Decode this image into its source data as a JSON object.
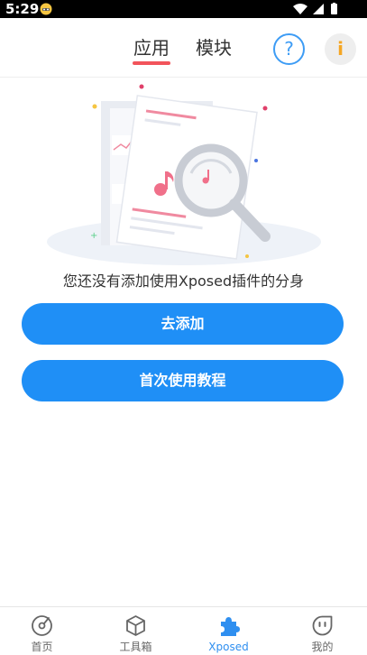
{
  "status_bar": {
    "time": "5:29"
  },
  "header": {
    "tabs": [
      {
        "label": "应用",
        "active": true
      },
      {
        "label": "模块",
        "active": false
      }
    ],
    "help_icon_glyph": "?",
    "info_icon_glyph": "i",
    "underline_color": "#f2545b"
  },
  "main": {
    "empty_message": "您还没有添加使用Xposed插件的分身",
    "add_button_label": "去添加",
    "tutorial_button_label": "首次使用教程"
  },
  "bottom_nav": {
    "items": [
      {
        "label": "首页",
        "icon": "home-disc-icon",
        "active": false
      },
      {
        "label": "工具箱",
        "icon": "box-icon",
        "active": false
      },
      {
        "label": "Xposed",
        "icon": "puzzle-icon",
        "active": true
      },
      {
        "label": "我的",
        "icon": "face-icon",
        "active": false
      }
    ]
  },
  "colors": {
    "primary": "#1f8ff6",
    "accent_red": "#f2545b",
    "accent_orange": "#f5a623",
    "help_blue": "#3d9cf5",
    "active_nav": "#2f8ff0"
  }
}
